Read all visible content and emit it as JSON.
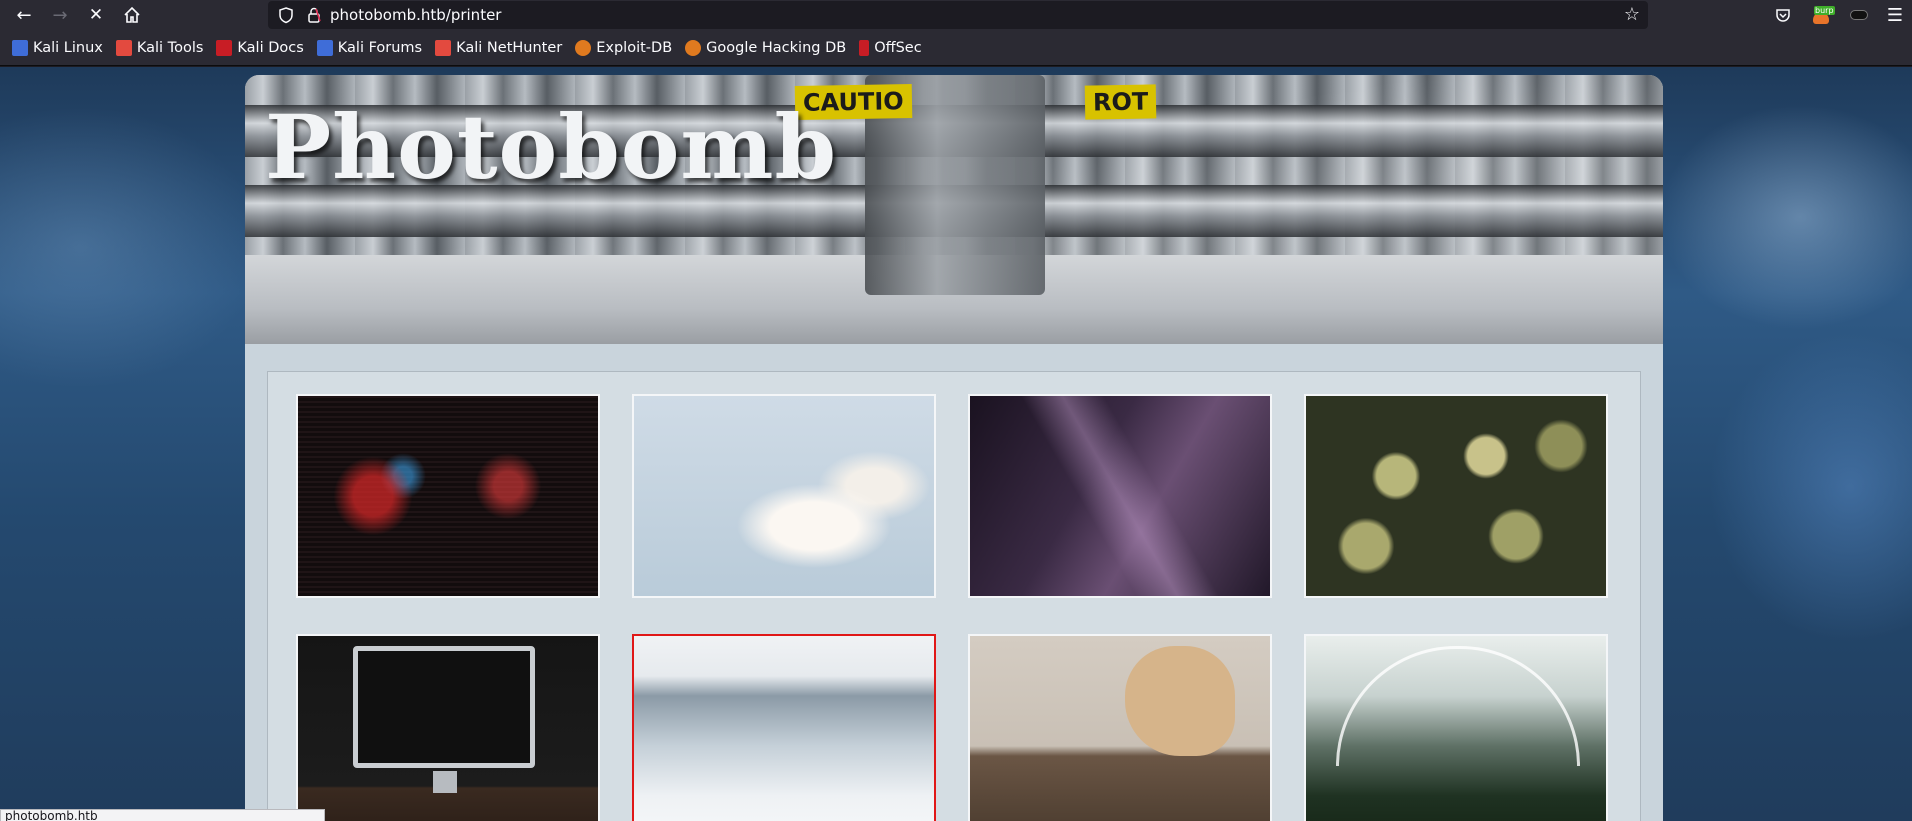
{
  "browser": {
    "url": "photobomb.htb/printer",
    "icons": [
      "back-arrow-icon",
      "forward-arrow-icon",
      "stop-loading-icon",
      "home-icon",
      "shield-icon",
      "lock-icon",
      "star-icon",
      "pocket-icon",
      "burp-extension-icon",
      "extension-icon",
      "hamburger-menu-icon"
    ],
    "extension_badge": "burp"
  },
  "bookmarks": [
    {
      "label": "Kali Linux",
      "color": "#3f6dd8"
    },
    {
      "label": "Kali Tools",
      "color": "#e34a3f"
    },
    {
      "label": "Kali Docs",
      "color": "#c81d25"
    },
    {
      "label": "Kali Forums",
      "color": "#3f6dd8"
    },
    {
      "label": "Kali NetHunter",
      "color": "#e34a3f"
    },
    {
      "label": "Exploit-DB",
      "color": "#e07a1f"
    },
    {
      "label": "Google Hacking DB",
      "color": "#e07a1f"
    },
    {
      "label": "OffSec",
      "color": "#c81d25"
    }
  ],
  "page": {
    "title": "Photobomb",
    "banner": {
      "caution_left": "CAUTIO",
      "caution_right": "ROT"
    },
    "photos": [
      {
        "subject": "red-neon-lights",
        "selected": false
      },
      {
        "subject": "white-blossoms",
        "selected": false
      },
      {
        "subject": "skyscrapers-night",
        "selected": false
      },
      {
        "subject": "succulent-plants",
        "selected": false
      },
      {
        "subject": "desktop-computer",
        "selected": false
      },
      {
        "subject": "frozen-waterfall",
        "selected": true
      },
      {
        "subject": "woodworking-guitar",
        "selected": false
      },
      {
        "subject": "greenhouse-conservatory",
        "selected": false
      }
    ]
  },
  "status_bar": {
    "link": "photobomb.htb"
  },
  "colors": {
    "selected_border": "#e01717",
    "toolbar_bg": "#2b2a33"
  }
}
